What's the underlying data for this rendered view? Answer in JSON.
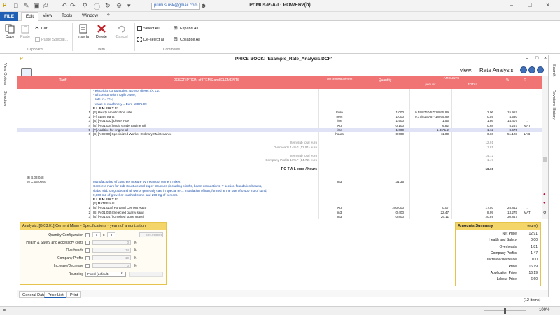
{
  "titlebar": {
    "email": "primus.usk@gmail.com",
    "title": "PriMus-P-A-I · POWER2(b)",
    "minimize": "–",
    "maximize": "□",
    "close": "×"
  },
  "menu": {
    "file": "FILE",
    "edit": "Edit",
    "view": "View",
    "tools": "Tools",
    "window": "Window",
    "help": "?"
  },
  "ribbon": {
    "copy": "Copy",
    "paste": "Paste",
    "cut": "Cut",
    "paste_special": "Paste Special...",
    "inserts": "Inserts",
    "delete": "Delete",
    "cancel": "Cancel",
    "select_all": "Select All",
    "deselect_all": "De-select all",
    "expand_all": "Expand All",
    "collapse_all": "Collapse All",
    "group_clipboard": "Clipboard",
    "group_item": "Item",
    "group_comments": "Comments"
  },
  "side": {
    "left1": "View Options",
    "left2": "Structure",
    "right1": "Search",
    "right2": "Revisions History"
  },
  "doc": {
    "title": "PRICE BOOK: 'Example_Rate_Analysis.DCF'",
    "view_label": "view:",
    "view_value": "Rate Analysis"
  },
  "table": {
    "headers": {
      "tariff": "Tariff",
      "description": "DESCRIPTION of ITEMS and ELEMENTS",
      "unit": "unit of measurement",
      "quantity": "Quantity",
      "amounts": "AMOUNTS",
      "per_unit": "per unit",
      "total": "TOTAL",
      "pct": "%",
      "r": "R"
    },
    "rows": [
      {
        "n": "",
        "tariff": "",
        "desc": "- electricity consumption: 4Kw or diesel: (A 1,2,",
        "unit": "",
        "qty": "",
        "pu": "",
        "tot": "",
        "pct": "",
        "r": "",
        "cls": "blue"
      },
      {
        "n": "",
        "tariff": "",
        "desc": "- oil consumption: Kg/h 0,400;",
        "unit": "",
        "qty": "",
        "pu": "",
        "tot": "",
        "pct": "",
        "r": "",
        "cls": "blue"
      },
      {
        "n": "",
        "tariff": "",
        "desc": "- rate: r = 7%;",
        "unit": "",
        "qty": "",
        "pu": "",
        "tot": "",
        "pct": "",
        "r": "",
        "cls": "blue"
      },
      {
        "n": "",
        "tariff": "",
        "desc": "- value of machinery = Euro 18075.99",
        "unit": "",
        "qty": "",
        "pu": "",
        "tot": "",
        "pct": "",
        "r": "",
        "cls": "blue"
      },
      {
        "n": "",
        "tariff": "",
        "desc": "E L E M E N T S:",
        "unit": "",
        "qty": "",
        "pu": "",
        "tot": "",
        "pct": "",
        "r": "",
        "cls": "bold"
      },
      {
        "n": "1",
        "tariff": "",
        "desc": "[F] Hourly amortization rate",
        "unit": "Euro",
        "qty": "1.000",
        "pu": "0.59/8760-57*18075.99",
        "tot": "2.06",
        "pct": "15.957",
        "r": "",
        "cls": ""
      },
      {
        "n": "2",
        "tariff": "",
        "desc": "[F] Spare parts",
        "unit": "perc",
        "qty": "1.000",
        "pu": "0.17/8160-57*18075.99",
        "tot": "0.59",
        "pct": "4.530",
        "r": "",
        "cls": ""
      },
      {
        "n": "3",
        "tariff": "",
        "desc": "[S] [A.01.002] Diesel Fuel",
        "unit": "litre",
        "qty": "1.500",
        "pu": "1.55",
        "tot": "1.86",
        "pct": "14.407",
        "r": "…",
        "cls": ""
      },
      {
        "n": "4",
        "tariff": "",
        "desc": "[S] [A.01.004] Multi Grade Engine Oil",
        "unit": "Kg",
        "qty": "0.100",
        "pu": "6.82",
        "tot": "0.68",
        "pct": "5.267",
        "r": "MAT",
        "cls": ""
      },
      {
        "n": "5",
        "tariff": "",
        "desc": "[F] Additive for engine oil",
        "unit": "litre",
        "qty": "1.000",
        "pu": "1.86*1.2",
        "tot": "1.12",
        "pct": "8.675",
        "r": "",
        "cls": "sel"
      },
      {
        "n": "6",
        "tariff": "",
        "desc": "[S] [A.02.00] Specialized Worker Ordinary Maintenance",
        "unit": "hours",
        "qty": "0.600",
        "pu": "11.00",
        "tot": "6.60",
        "pct": "51.123",
        "r": "LAB",
        "cls": ""
      },
      {
        "n": "",
        "tariff": "",
        "desc": "",
        "unit": "",
        "qty": "",
        "pu": "",
        "tot": "",
        "pct": "",
        "r": "",
        "cls": ""
      },
      {
        "n": "",
        "tariff": "",
        "desc": "Item sub total euro",
        "unit": "",
        "qty": "",
        "pu": "",
        "tot": "12.91",
        "pct": "",
        "r": "",
        "cls": "gr"
      },
      {
        "n": "",
        "tariff": "",
        "desc": "Overheads 14% * (12.91) euro",
        "unit": "",
        "qty": "",
        "pu": "",
        "tot": "1.81",
        "pct": "",
        "r": "",
        "cls": "gr"
      },
      {
        "n": "",
        "tariff": "",
        "desc": "",
        "unit": "",
        "qty": "",
        "pu": "",
        "tot": "",
        "pct": "",
        "r": "",
        "cls": ""
      },
      {
        "n": "",
        "tariff": "",
        "desc": "Item sub total euro",
        "unit": "",
        "qty": "",
        "pu": "",
        "tot": "14.72",
        "pct": "",
        "r": "",
        "cls": "gr"
      },
      {
        "n": "",
        "tariff": "",
        "desc": "Company Profits 10% * (14.72) euro",
        "unit": "",
        "qty": "",
        "pu": "",
        "tot": "1.47",
        "pct": "",
        "r": "",
        "cls": "gr"
      },
      {
        "n": "",
        "tariff": "",
        "desc": "",
        "unit": "",
        "qty": "",
        "pu": "",
        "tot": "",
        "pct": "",
        "r": "",
        "cls": ""
      },
      {
        "n": "",
        "tariff": "",
        "desc": "T O T A L  euro / hours",
        "unit": "",
        "qty": "",
        "pu": "",
        "tot": "16.19",
        "pct": "",
        "r": "",
        "cls": "tot"
      },
      {
        "n": "",
        "tariff": "",
        "desc": "",
        "unit": "",
        "qty": "",
        "pu": "",
        "tot": "",
        "pct": "",
        "r": "",
        "cls": ""
      },
      {
        "n": "",
        "tariff": "⊞  B.03.048",
        "desc": "",
        "unit": "",
        "qty": "",
        "pu": "",
        "tot": "",
        "pct": "",
        "r": "",
        "cls": ""
      },
      {
        "n": "",
        "tariff": "⊟  C.05.006A",
        "desc": "Manufacturing of concrete mixture by means of cement mixer.",
        "unit": "m3",
        "qty": "31.35",
        "pu": "",
        "tot": "",
        "pct": "",
        "r": "",
        "cls": "blue"
      },
      {
        "n": "",
        "tariff": "",
        "desc": "Concrete mark for sub-structure and super-structure (including plinths, beam connections, T-section foundation beams,",
        "unit": "",
        "qty": "",
        "pu": "",
        "tot": "",
        "pct": "",
        "r": "",
        "cls": "blue"
      },
      {
        "n": "",
        "tariff": "",
        "desc": "slabs, slab on grade and all works generally cast in special re ... installation of iron, formed at the rate of 0,400 m3 of sand,",
        "unit": "",
        "qty": "",
        "pu": "",
        "tot": "",
        "pct": "",
        "r": "",
        "cls": "blue"
      },
      {
        "n": "",
        "tariff": "",
        "desc": "0,800 m3 of gravel or crushed stone and 250 Kg of cement.",
        "unit": "",
        "qty": "",
        "pu": "",
        "tot": "",
        "pct": "",
        "r": "",
        "cls": "blue"
      },
      {
        "n": "",
        "tariff": "",
        "desc": "E L E M E N T S:",
        "unit": "",
        "qty": "",
        "pu": "",
        "tot": "",
        "pct": "",
        "r": "",
        "cls": "bold"
      },
      {
        "n": "",
        "tariff": "",
        "desc": "[F] MATERIALI",
        "unit": "",
        "qty": "",
        "pu": "",
        "tot": "",
        "pct": "",
        "r": "",
        "cls": ""
      },
      {
        "n": "1",
        "tariff": "",
        "desc": "[S] [A.01.01A] Portland Cement R325",
        "unit": "Kg",
        "qty": "250.000",
        "pu": "0.07",
        "tot": "17.50",
        "pct": "25.842",
        "r": "…",
        "cls": ""
      },
      {
        "n": "2",
        "tariff": "",
        "desc": "[S] [A.01.045] Selected quarry sand",
        "unit": "m3",
        "qty": "0.400",
        "pu": "22.47",
        "tot": "8.99",
        "pct": "13.275",
        "r": "MAT",
        "cls": ""
      },
      {
        "n": "3",
        "tariff": "",
        "desc": "[S] [A.01.047] Crushed stone gravel",
        "unit": "m3",
        "qty": "0.800",
        "pu": "26.11",
        "tot": "20.89",
        "pct": "30.847",
        "r": "",
        "cls": ""
      }
    ]
  },
  "analysis": {
    "header": "Analysis: [B.03.01] Cement Mixer - Specifications - years of amortization",
    "quantity_config": "Quantity Configuration",
    "q_val1": "1",
    "q_sep": "x",
    "q_val2": "0",
    "q_result": "999.999999",
    "hs_label": "Health & Safety and Accessory costs",
    "hs_val": "0",
    "overheads_label": "Overheads",
    "overheads_val": "14",
    "profits_label": "Company Profits",
    "profits_val": "10",
    "incdec_label": "Increase/Decrease",
    "incdec_val": "0",
    "rounding_label": "Rounding",
    "rounding_val": "Fixed (default)",
    "pct": "%"
  },
  "amounts": {
    "header": "Amounts Summary",
    "currency": "(euro)",
    "rows": [
      {
        "label": "Net Price",
        "value": "12.91"
      },
      {
        "label": "Health and Safety",
        "value": "0.00"
      },
      {
        "label": "Overheads",
        "value": "1.81"
      },
      {
        "label": "Company Profits",
        "value": "1.47"
      },
      {
        "label": "Increase/Decrease",
        "value": "0.00"
      },
      {
        "label": "Price",
        "value": "16.19"
      },
      {
        "label": "Application Price",
        "value": "16.19"
      },
      {
        "label": "Labour Price",
        "value": "6.60"
      }
    ]
  },
  "bottom_tabs": {
    "general": "General Data",
    "price_list": "Price List",
    "print": "Print"
  },
  "status": {
    "items": "(12 items)",
    "zoom": "100%"
  }
}
